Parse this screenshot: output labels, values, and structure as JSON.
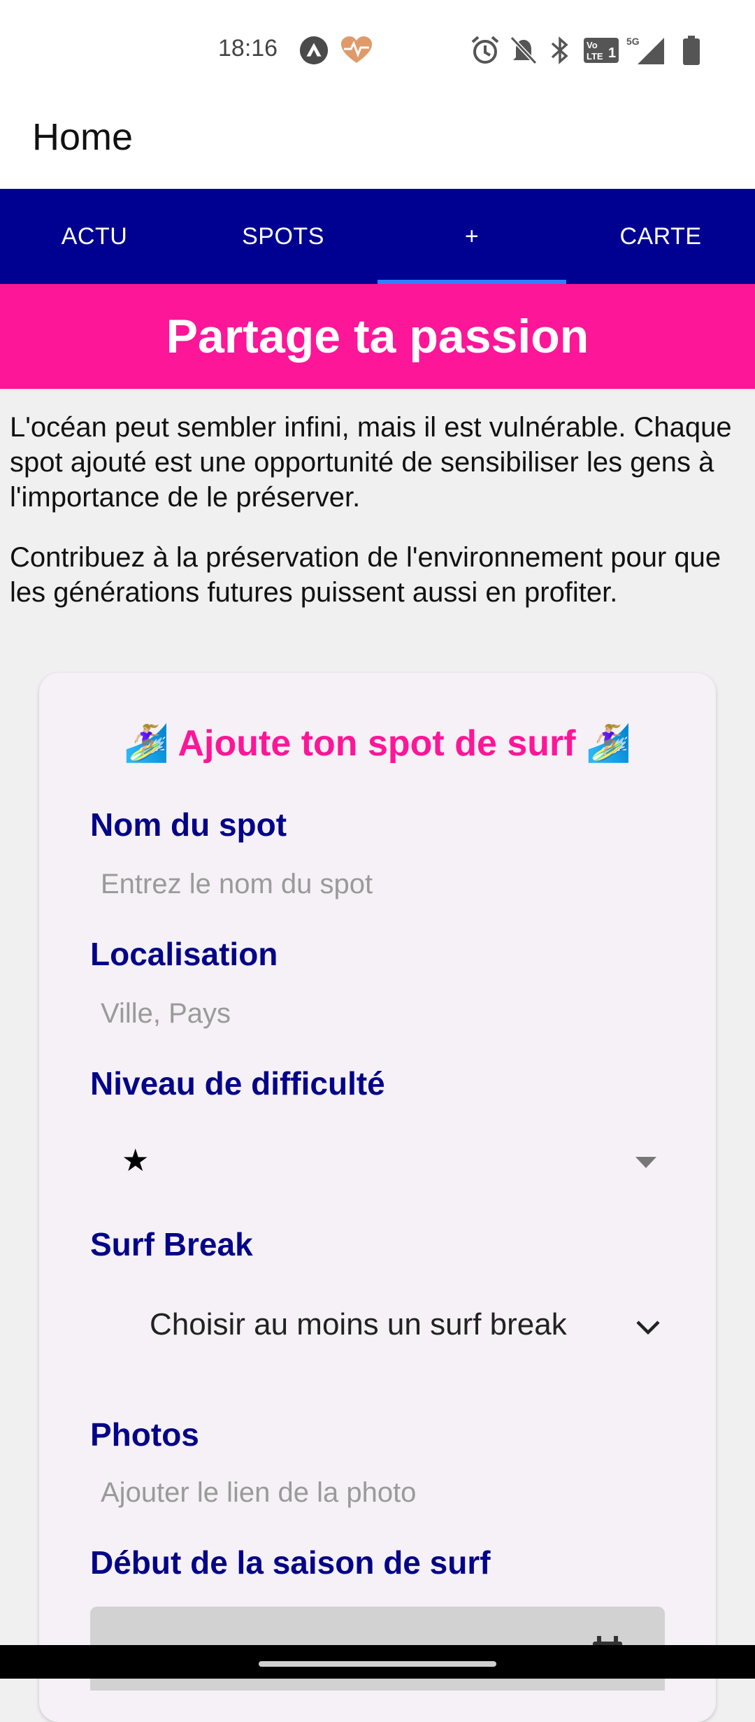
{
  "status_bar": {
    "time": "18:16",
    "icons": [
      "app-a-icon",
      "heart-pulse-icon",
      "alarm-icon",
      "bell-off-icon",
      "bluetooth-icon",
      "volte-icon",
      "signal-5g-icon",
      "battery-icon"
    ],
    "volte_label": "Vo LTE 1",
    "network_label": "5G"
  },
  "app_bar": {
    "title": "Home"
  },
  "tabs": [
    {
      "label": "ACTU"
    },
    {
      "label": "SPOTS"
    },
    {
      "label": "+"
    },
    {
      "label": "CARTE"
    }
  ],
  "active_tab": "+",
  "banner": {
    "title": "Partage ta passion"
  },
  "intro": {
    "paragraph1": "L'océan peut sembler infini, mais il est vulnérable. Chaque spot ajouté est une opportunité de sensibiliser les gens à l'importance de le préserver.",
    "paragraph2": "Contribuez à la préservation de l'environnement pour que les générations futures puissent aussi en profiter."
  },
  "form": {
    "title": "🏄🏼‍♀️ Ajoute ton spot de surf 🏄🏼‍♀️",
    "spot_name": {
      "label": "Nom du spot",
      "placeholder": "Entrez le nom du spot"
    },
    "location": {
      "label": "Localisation",
      "placeholder": "Ville, Pays"
    },
    "difficulty": {
      "label": "Niveau de difficulté",
      "value": "★"
    },
    "surf_break": {
      "label": "Surf Break",
      "value": "Choisir au moins un surf break"
    },
    "photos": {
      "label": "Photos",
      "placeholder": "Ajouter le lien de la photo"
    },
    "season_start": {
      "label": "Début de la saison de surf"
    }
  },
  "colors": {
    "tab_bar": "#010191",
    "tab_indicator": "#2f80ff",
    "banner": "#fd1697",
    "label": "#040488",
    "form_title": "#fd1697"
  }
}
